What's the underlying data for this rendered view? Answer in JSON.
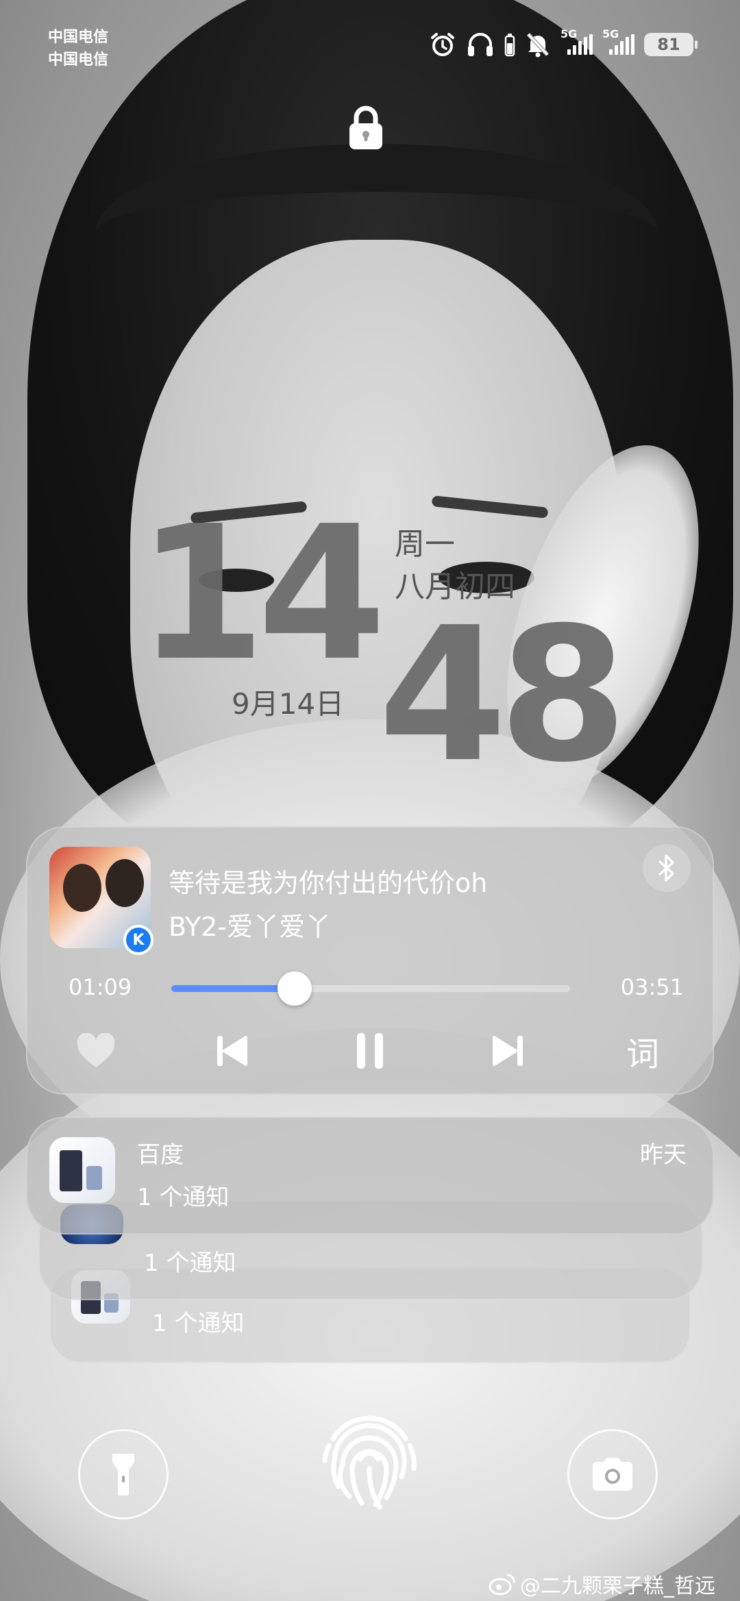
{
  "status_bar": {
    "carrier_1": "中国电信",
    "carrier_2": "中国电信",
    "icons": [
      "alarm-icon",
      "headphones-icon",
      "mute-icon"
    ],
    "sim1_label": "5G",
    "sim2_label": "5G",
    "battery": "81"
  },
  "clock": {
    "hour": "14",
    "minute": "48",
    "weekday": "周一",
    "lunar_date": "八月初四",
    "date": "9月14日"
  },
  "media": {
    "title": "等待是我为你付出的代价oh",
    "artist": "BY2-爱丫爱丫",
    "elapsed": "01:09",
    "total": "03:51",
    "progress_fraction": 0.31,
    "app_badge": "K",
    "lyrics_label": "词",
    "accent_color": "#5c8cff"
  },
  "notifications": [
    {
      "app": "百度",
      "time": "昨天",
      "body": "1 个通知"
    },
    {
      "body": "1 个通知"
    },
    {
      "body": "1 个通知"
    }
  ],
  "watermark": "@二九颗栗子糕_哲远"
}
